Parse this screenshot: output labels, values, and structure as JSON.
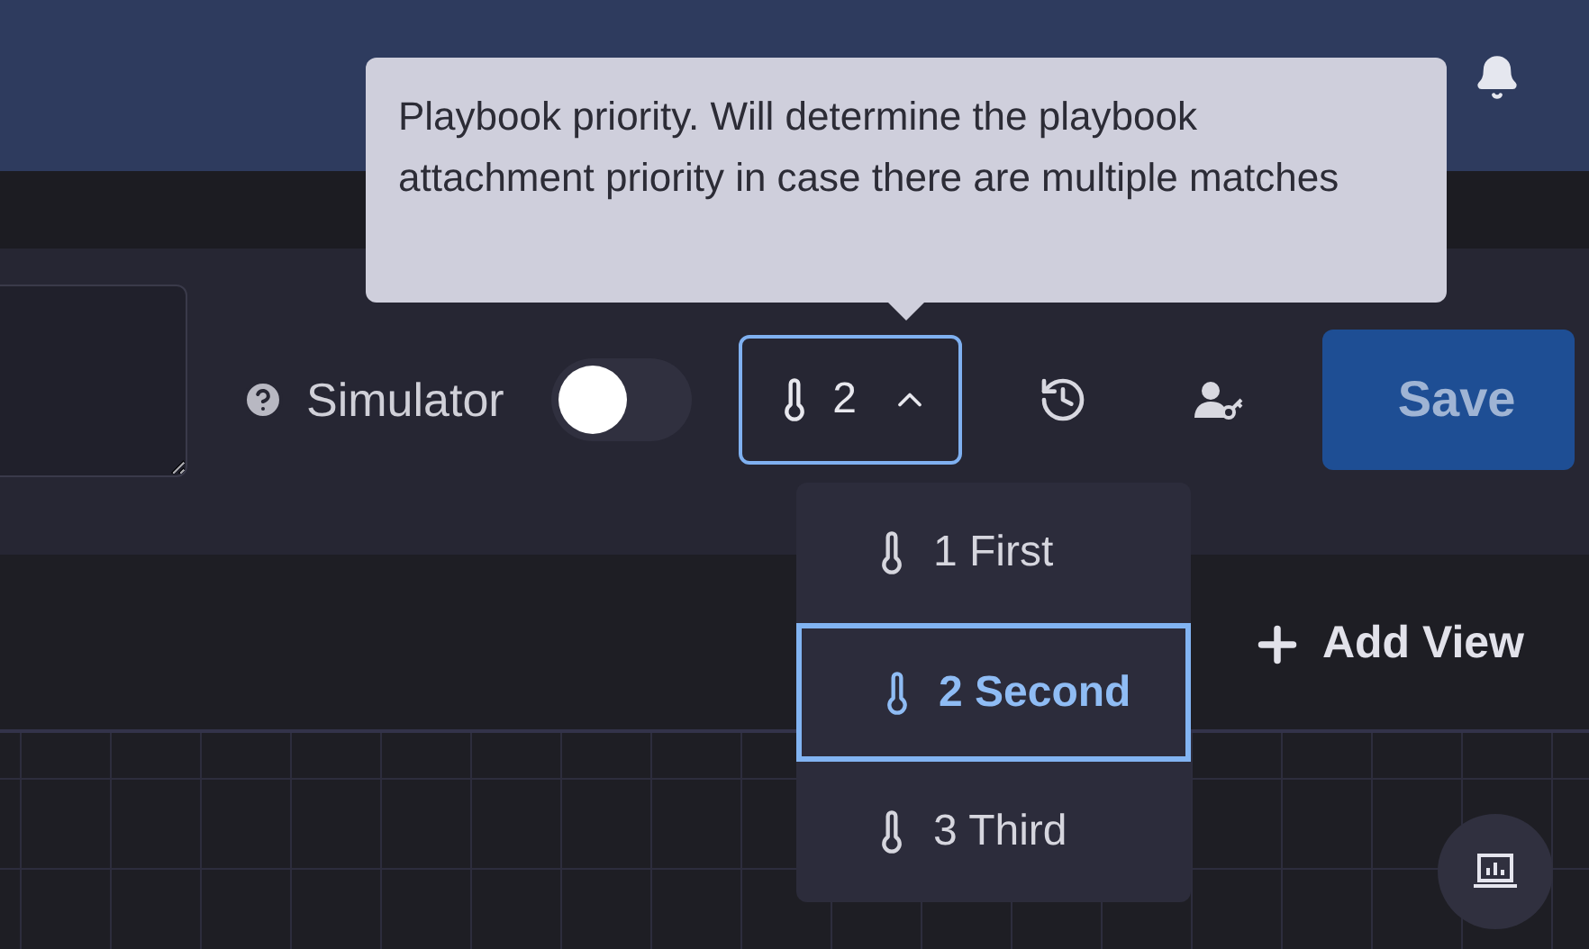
{
  "tooltip": {
    "text": "Playbook priority. Will determine the playbook attachment priority in case there are multiple matches"
  },
  "toolbar": {
    "simulator": {
      "label": "Simulator",
      "on": false
    },
    "priority": {
      "value": "2",
      "expanded": true
    },
    "save_button": "Save"
  },
  "priority_menu": [
    {
      "label": "1 First",
      "selected": false
    },
    {
      "label": "2 Second",
      "selected": true
    },
    {
      "label": "3 Third",
      "selected": false
    }
  ],
  "add_view": "Add View"
}
